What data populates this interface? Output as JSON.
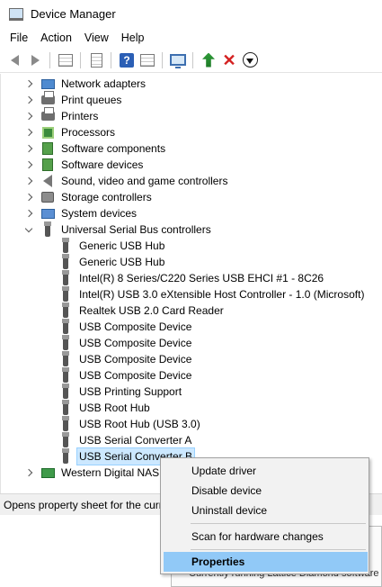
{
  "window": {
    "title": "Device Manager"
  },
  "menu": [
    "File",
    "Action",
    "View",
    "Help"
  ],
  "toolbar": {
    "icons": [
      "back-arrow-icon",
      "forward-arrow-icon",
      "show-hide-console-tree-icon",
      "properties-icon",
      "help-icon",
      "action-pane-icon",
      "scan-hardware-icon",
      "update-driver-icon",
      "uninstall-icon",
      "disable-device-icon"
    ]
  },
  "tree": {
    "categories_top": [
      {
        "label": "Network adapters",
        "icon": "network-adapter-icon"
      },
      {
        "label": "Print queues",
        "icon": "print-queue-icon"
      },
      {
        "label": "Printers",
        "icon": "printer-icon"
      },
      {
        "label": "Processors",
        "icon": "processor-icon"
      },
      {
        "label": "Software components",
        "icon": "software-component-icon"
      },
      {
        "label": "Software devices",
        "icon": "software-device-icon"
      },
      {
        "label": "Sound, video and game controllers",
        "icon": "speaker-icon"
      },
      {
        "label": "Storage controllers",
        "icon": "storage-controller-icon"
      },
      {
        "label": "System devices",
        "icon": "system-device-icon"
      }
    ],
    "usb_category": {
      "label": "Universal Serial Bus controllers",
      "expanded": true
    },
    "usb_devices": [
      "Generic USB Hub",
      "Generic USB Hub",
      "Intel(R) 8 Series/C220 Series USB EHCI #1 - 8C26",
      "Intel(R) USB 3.0 eXtensible Host Controller - 1.0 (Microsoft)",
      "Realtek USB 2.0 Card Reader",
      "USB Composite Device",
      "USB Composite Device",
      "USB Composite Device",
      "USB Composite Device",
      "USB Printing Support",
      "USB Root Hub",
      "USB Root Hub (USB 3.0)",
      "USB Serial Converter A",
      "USB Serial Converter B"
    ],
    "selected_device": "USB Serial Converter B",
    "last_category": {
      "label": "Western Digital NAS",
      "icon": "nas-icon"
    }
  },
  "status_bar": {
    "text": "Opens property sheet for the curr"
  },
  "background_window": {
    "text": "Currently running Lattice Diamond software"
  },
  "context_menu": {
    "items": [
      {
        "label": "Update driver"
      },
      {
        "label": "Disable device"
      },
      {
        "label": "Uninstall device"
      },
      {
        "label": "Scan for hardware changes"
      },
      {
        "label": "Properties",
        "bold": true,
        "highlighted": true
      }
    ]
  }
}
